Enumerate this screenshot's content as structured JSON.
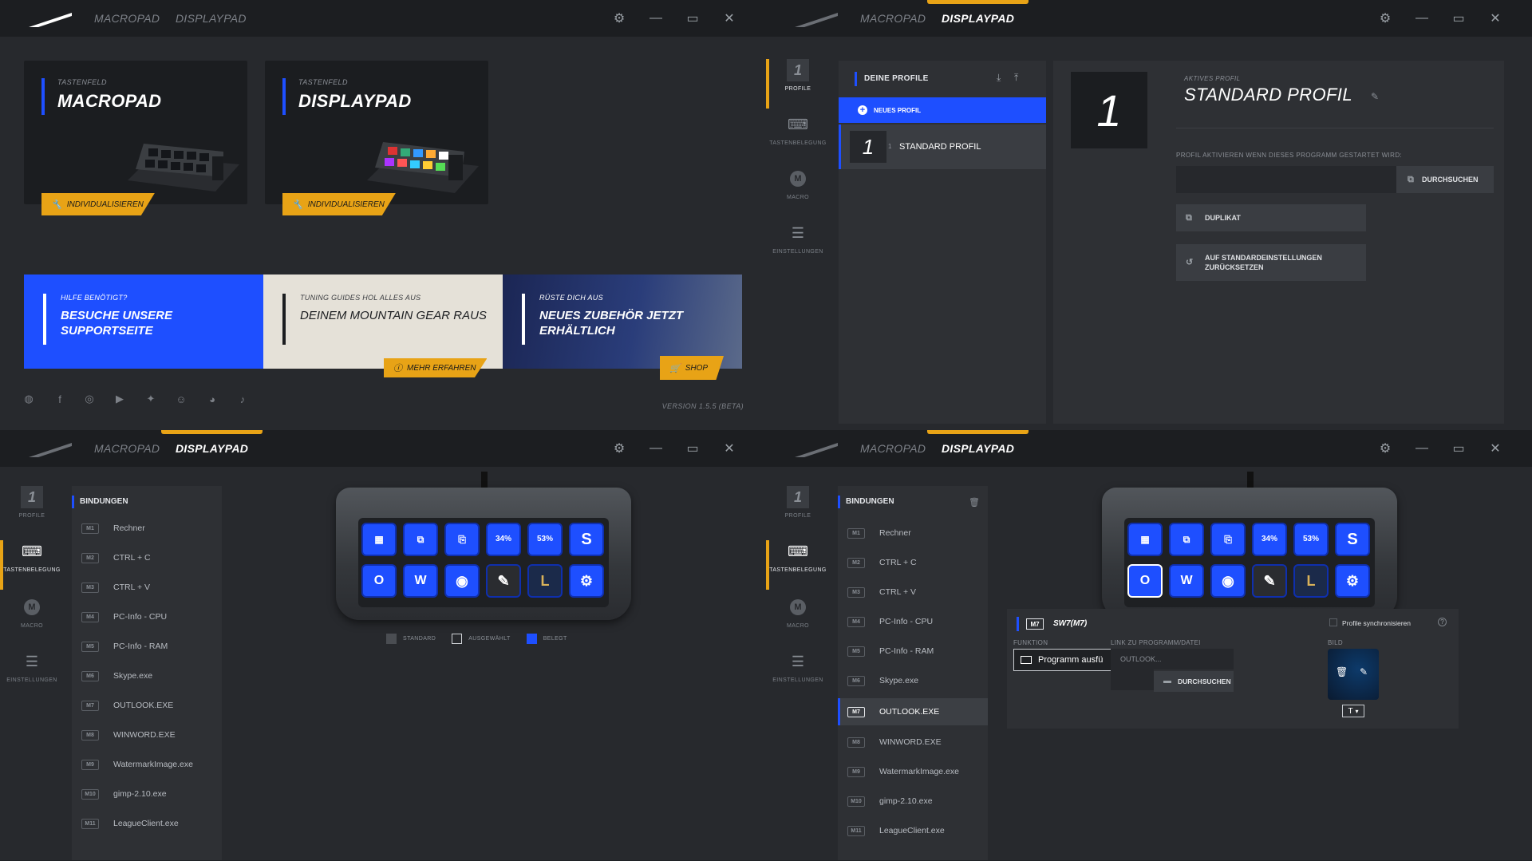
{
  "tabs": {
    "macropad": "MACROPAD",
    "displaypad": "DISPLAYPAD"
  },
  "colors": {
    "accent": "#e8a316",
    "brand_blue": "#1e4fff",
    "bg": "#27292d"
  },
  "home": {
    "cards": [
      {
        "sub": "TASTENFELD",
        "title": "MACROPAD",
        "button": "INDIVIDUALISIEREN"
      },
      {
        "sub": "TASTENFELD",
        "title": "DISPLAYPAD",
        "button": "INDIVIDUALISIEREN"
      }
    ],
    "banners": [
      {
        "sub": "HILFE BENÖTIGT?",
        "title": "BESUCHE UNSERE SUPPORTSEITE"
      },
      {
        "sub": "TUNING GUIDES HOL ALLES AUS",
        "title": "DEINEM MOUNTAIN GEAR RAUS",
        "button": "MEHR ERFAHREN"
      },
      {
        "sub": "RÜSTE DICH AUS",
        "title": "NEUES ZUBEHÖR JETZT ERHÄLTLICH",
        "button": "SHOP"
      }
    ],
    "social_icons": [
      "globe-icon",
      "facebook-icon",
      "instagram-icon",
      "youtube-icon",
      "twitter-icon",
      "discord-icon",
      "reddit-icon",
      "tiktok-icon"
    ],
    "version": "VERSION 1.5.5 (BETA)"
  },
  "nav": {
    "profile_num": "1",
    "profile": "PROFILE",
    "keys": "TASTENBELEGUNG",
    "macro": "MACRO",
    "macro_letter": "M",
    "settings": "EINSTELLUNGEN"
  },
  "profiles": {
    "header": "DEINE PROFILE",
    "new_profile": "NEUES PROFIL",
    "list": [
      {
        "num": "1",
        "index": "1",
        "name": "STANDARD PROFIL"
      }
    ],
    "active_label": "AKTIVES PROFIL",
    "active_name": "STANDARD PROFIL",
    "active_num": "1",
    "activate_label": "PROFIL AKTIVIEREN WENN DIESES PROGRAMM GESTARTET WIRD:",
    "browse": "DURCHSUCHEN",
    "duplicate": "DUPLIKAT",
    "reset": "AUF STANDARDEINSTELLUNGEN ZURÜCKSETZEN"
  },
  "bindings": {
    "header": "BINDUNGEN",
    "items": [
      {
        "key": "M1",
        "label": "Rechner"
      },
      {
        "key": "M2",
        "label": "CTRL + C"
      },
      {
        "key": "M3",
        "label": "CTRL + V"
      },
      {
        "key": "M4",
        "label": "PC-Info - CPU"
      },
      {
        "key": "M5",
        "label": "PC-Info - RAM"
      },
      {
        "key": "M6",
        "label": "Skype.exe"
      },
      {
        "key": "M7",
        "label": "OUTLOOK.EXE"
      },
      {
        "key": "M8",
        "label": "WINWORD.EXE"
      },
      {
        "key": "M9",
        "label": "WatermarkImage.exe"
      },
      {
        "key": "M10",
        "label": "gimp-2.10.exe"
      },
      {
        "key": "M11",
        "label": "LeagueClient.exe"
      }
    ]
  },
  "device": {
    "keys": [
      {
        "icon": "calculator-icon",
        "glyph": "▦"
      },
      {
        "icon": "copy-icon",
        "glyph": "⧉"
      },
      {
        "icon": "paste-icon",
        "glyph": "⎘"
      },
      {
        "icon": "cpu-icon",
        "glyph": "34%"
      },
      {
        "icon": "ram-icon",
        "glyph": "53%"
      },
      {
        "icon": "skype-icon",
        "glyph": "S"
      },
      {
        "icon": "outlook-icon",
        "glyph": "O"
      },
      {
        "icon": "word-icon",
        "glyph": "W"
      },
      {
        "icon": "watermark-icon",
        "glyph": "◉"
      },
      {
        "icon": "gimp-icon",
        "glyph": "✎"
      },
      {
        "icon": "league-icon",
        "glyph": "L"
      },
      {
        "icon": "steam-icon",
        "glyph": "⚙"
      }
    ],
    "legend": {
      "standard": "STANDARD",
      "selected": "AUSGEWÄHLT",
      "bound": "BELEGT"
    }
  },
  "detail": {
    "key": "M7",
    "title": "SW7(M7)",
    "sync": "Profile synchronisieren",
    "function_label": "FUNKTION",
    "function_value": "Programm ausfü",
    "link_label": "LINK ZU PROGRAMM/DATEI",
    "link_placeholder": "OUTLOOK...",
    "browse": "DURCHSUCHEN",
    "image_label": "BILD",
    "font_btn": "T"
  }
}
